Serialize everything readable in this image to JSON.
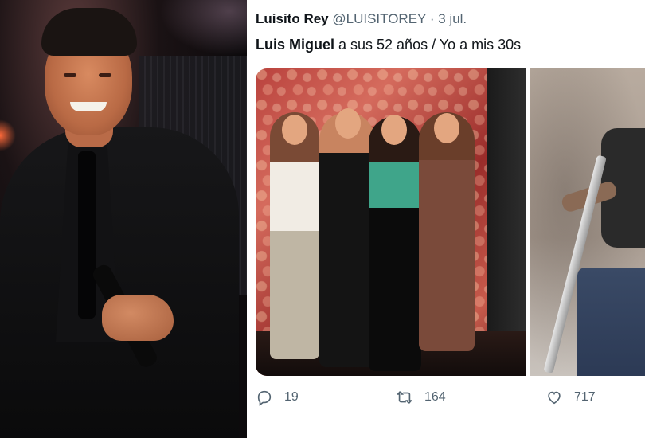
{
  "tweet": {
    "display_name": "Luisito Rey",
    "handle": "@LUISITOREY",
    "separator": "·",
    "date": "3 jul.",
    "text_bold": "Luis Miguel",
    "text_rest": " a sus 52 años / Yo a mis 30s",
    "reply_count": "19",
    "retweet_count": "164",
    "like_count": "717"
  },
  "icons": {
    "reply": "reply-icon",
    "retweet": "retweet-icon",
    "like": "heart-icon"
  },
  "colors": {
    "text_primary": "#0f1419",
    "text_secondary": "#536471",
    "background": "#ffffff"
  }
}
